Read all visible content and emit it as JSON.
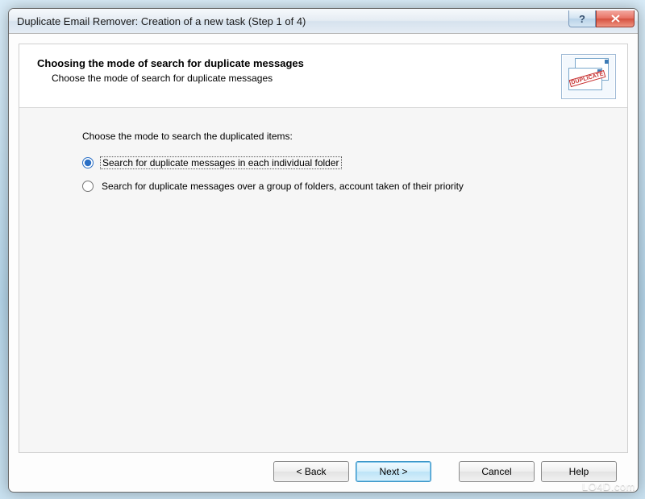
{
  "window": {
    "title": "Duplicate Email Remover: Creation of a new task (Step 1 of 4)"
  },
  "header": {
    "title": "Choosing the mode of search for duplicate messages",
    "subtitle": "Choose the mode of search for duplicate messages",
    "icon_stamp": "DUPLICATE"
  },
  "body": {
    "instruction": "Choose the mode to search the duplicated items:",
    "options": [
      {
        "label": "Search for duplicate messages in each individual folder",
        "selected": true
      },
      {
        "label": "Search for duplicate messages over a group of folders, account taken of their priority",
        "selected": false
      }
    ]
  },
  "buttons": {
    "back": "< Back",
    "next": "Next >",
    "cancel": "Cancel",
    "help": "Help"
  },
  "watermark": "LO4D.com"
}
